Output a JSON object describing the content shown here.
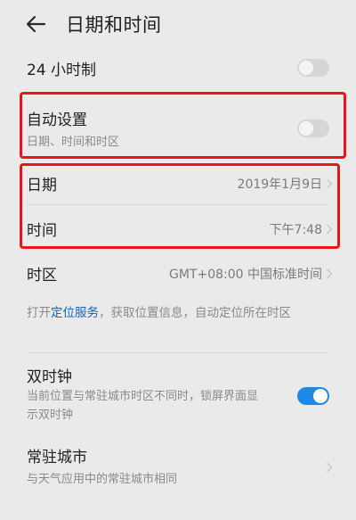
{
  "header": {
    "title": "日期和时间"
  },
  "rows": {
    "h24": {
      "label": "24 小时制"
    },
    "auto": {
      "label": "自动设置",
      "sub": "日期、时间和时区"
    },
    "date": {
      "label": "日期",
      "value": "2019年1月9日"
    },
    "time": {
      "label": "时间",
      "value": "下午7:48"
    },
    "tz": {
      "label": "时区",
      "value": "GMT+08:00 中国标准时间"
    }
  },
  "info": {
    "prefix": "打开",
    "link": "定位服务",
    "suffix": "，获取位置信息，自动定位所在时区"
  },
  "dual_clock": {
    "label": "双时钟",
    "sub": "当前位置与常驻城市时区不同时，锁屏界面显示双时钟"
  },
  "home_city": {
    "label": "常驻城市",
    "sub": "与天气应用中的常驻城市相同"
  },
  "colors": {
    "highlight": "#e8151b",
    "toggle_on": "#1e88e5",
    "link": "#1565c0"
  }
}
